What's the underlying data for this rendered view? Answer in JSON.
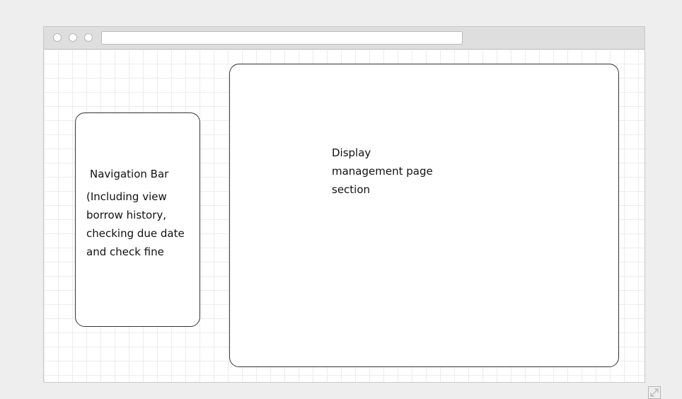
{
  "navigation": {
    "title": "Navigation Bar",
    "description": "(Including view\nborrow history,\nchecking due date\nand check fine"
  },
  "display_section": {
    "label": "Display\nmanagement page\nsection"
  },
  "icons": {
    "window_controls": [
      "window-close-dot-icon",
      "window-minimize-dot-icon",
      "window-maximize-dot-icon"
    ],
    "expand": "expand-icon"
  }
}
